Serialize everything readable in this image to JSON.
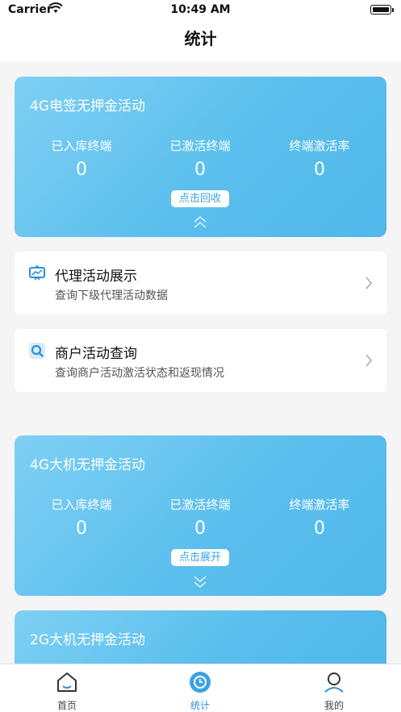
{
  "status_bar": {
    "carrier": "Carrier",
    "time": "10:49 AM"
  },
  "nav": {
    "title": "统计"
  },
  "cards": [
    {
      "title": "4G电签无押金活动",
      "stats": [
        {
          "label": "已入库终端",
          "value": "0"
        },
        {
          "label": "已激活终端",
          "value": "0"
        },
        {
          "label": "终端激活率",
          "value": "0"
        }
      ],
      "toggle_label": "点击回收",
      "chevron": "chevron-up-icon"
    },
    {
      "title": "4G大机无押金活动",
      "stats": [
        {
          "label": "已入库终端",
          "value": "0"
        },
        {
          "label": "已激活终端",
          "value": "0"
        },
        {
          "label": "终端激活率",
          "value": "0"
        }
      ],
      "toggle_label": "点击展开",
      "chevron": "chevron-down-icon"
    },
    {
      "title": "2G大机无押金活动"
    }
  ],
  "menu": [
    {
      "title": "代理活动展示",
      "subtitle": "查询下级代理活动数据",
      "icon": "agent-display-icon"
    },
    {
      "title": "商户活动查询",
      "subtitle": "查询商户活动激活状态和返现情况",
      "icon": "merchant-search-icon"
    }
  ],
  "tabbar": {
    "items": [
      {
        "label": "首页",
        "icon": "home-icon"
      },
      {
        "label": "统计",
        "icon": "statistics-icon",
        "active": true
      },
      {
        "label": "我的",
        "icon": "profile-icon"
      }
    ]
  },
  "colors": {
    "card_gradient_start": "#7fd0f4",
    "card_gradient_end": "#4fb7ea",
    "accent": "#2d8fd9"
  }
}
